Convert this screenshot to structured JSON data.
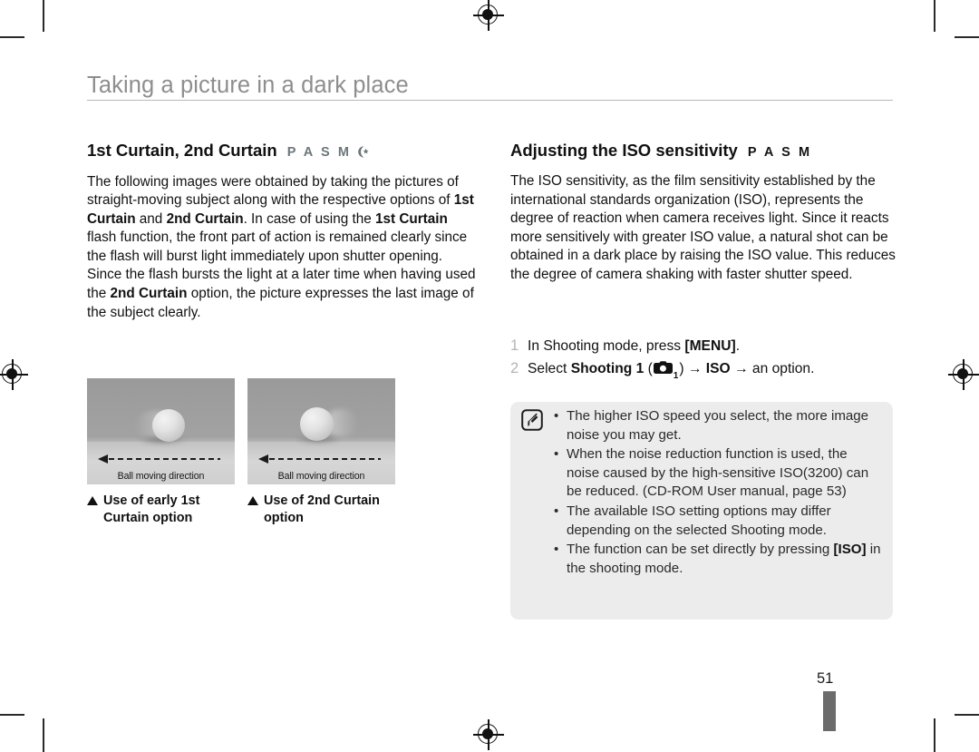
{
  "page": {
    "title": "Taking a picture in a dark place",
    "number": "51"
  },
  "left_column": {
    "heading": "1st Curtain, 2nd Curtain",
    "modes": "P A S M",
    "mode_night_icon": "crescent-moon-star-icon",
    "paragraph_html": "The following images were obtained by taking the pictures of straight-moving subject along with the respective options of <b>1st Curtain</b> and <b>2nd Curtain</b>. In case of using the <b>1st Curtain</b> flash function, the front part of action is remained clearly since the flash will burst light immediately upon shutter opening. Since the flash bursts the light at a later time when having used the <b>2nd Curtain</b> option, the picture expresses the last image of the subject clearly.",
    "thumbnails": [
      {
        "inner_label": "Ball moving direction",
        "caption": "Use of early 1st Curtain option"
      },
      {
        "inner_label": "Ball moving direction",
        "caption": "Use of 2nd Curtain option"
      }
    ]
  },
  "right_column": {
    "heading": "Adjusting the ISO sensitivity",
    "modes": "P A S M",
    "paragraph": "The ISO sensitivity, as the film sensitivity established by the international standards organization (ISO), represents the degree of reaction when camera receives light. Since it reacts more sensitively with greater ISO value, a natural shot can be obtained in a dark place by raising the ISO value. This reduces the degree of camera shaking with faster shutter speed.",
    "steps": [
      {
        "num": "1",
        "html": "In Shooting mode, press <b>[MENU]</b>."
      },
      {
        "num": "2",
        "html": "Select <b>Shooting 1</b> (CAM_ICON) → <b>ISO</b> → an option."
      }
    ],
    "note_box": {
      "icon": "note-pencil-icon",
      "items": [
        "The higher ISO speed you select, the more image noise you may get.",
        "When the noise reduction function is used, the noise caused by the high-sensitive ISO(3200) can be reduced. (CD-ROM User manual, page 53)",
        "The available ISO setting options may differ depending on the selected Shooting mode.",
        "The function can be set directly by pressing <b>[ISO]</b> in the shooting mode."
      ]
    }
  },
  "print_marks": {
    "registration_icon": "registration-crosshair-icon",
    "crop_mark_icon": "crop-mark-icon"
  }
}
